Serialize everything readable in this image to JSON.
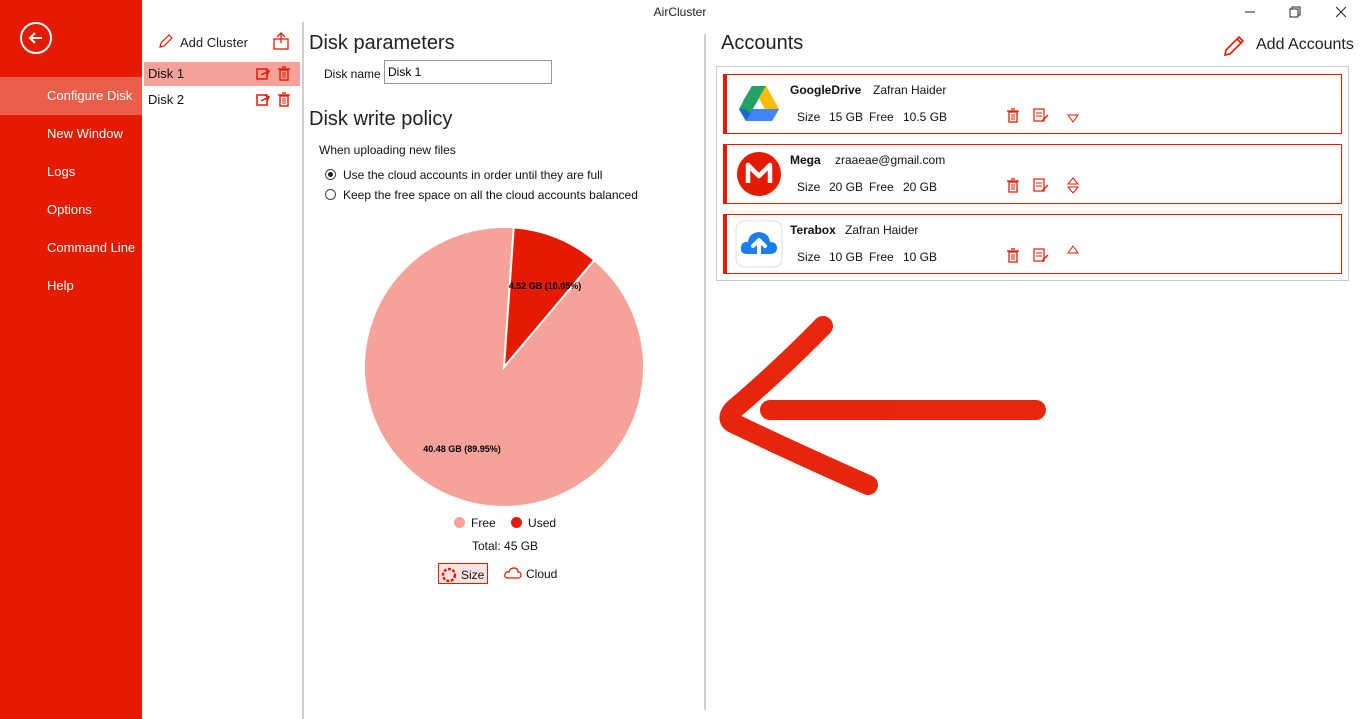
{
  "window": {
    "title": "AirCluster"
  },
  "sidebar": {
    "items": [
      {
        "label": "Configure Disk",
        "active": true
      },
      {
        "label": "New Window"
      },
      {
        "label": "Logs"
      },
      {
        "label": "Options"
      },
      {
        "label": "Command Line"
      },
      {
        "label": "Help"
      }
    ]
  },
  "clusters": {
    "add_label": "Add Cluster",
    "disks": [
      {
        "name": "Disk 1",
        "selected": true
      },
      {
        "name": "Disk 2"
      }
    ]
  },
  "disk_parameters": {
    "title": "Disk parameters",
    "name_label": "Disk name",
    "name_value": "Disk 1"
  },
  "write_policy": {
    "title": "Disk write policy",
    "caption": "When uploading new files",
    "options": [
      {
        "label": "Use the cloud accounts in order until they are full",
        "checked": true
      },
      {
        "label": "Keep the free space on all the cloud accounts balanced",
        "checked": false
      }
    ]
  },
  "chart_data": {
    "type": "pie",
    "slices": [
      {
        "label": "Free",
        "value": 40.48,
        "display": "40.48 GB (89.95%)",
        "color": "#f4a29a"
      },
      {
        "label": "Used",
        "value": 4.52,
        "display": "4.52 GB (10.05%)",
        "color": "#e51b00"
      }
    ],
    "legend": [
      "Free",
      "Used"
    ],
    "total_label": "Total: 45 GB"
  },
  "view_toggle": {
    "size_label": "Size",
    "cloud_label": "Cloud",
    "selected": "Size"
  },
  "accounts": {
    "title": "Accounts",
    "add_label": "Add Accounts",
    "size_label": "Size",
    "free_label": "Free",
    "items": [
      {
        "provider": "GoogleDrive",
        "user": "Zafran Haider",
        "size": "15 GB",
        "free": "10.5 GB",
        "order_icon": "move-down-icon"
      },
      {
        "provider": "Mega",
        "user": "zraaeae@gmail.com",
        "size": "20 GB",
        "free": "20 GB",
        "order_icon": "move-up-down-icon"
      },
      {
        "provider": "Terabox",
        "user": "Zafran Haider",
        "size": "10 GB",
        "free": "10 GB",
        "order_icon": "move-up-icon"
      }
    ]
  },
  "colors": {
    "accent": "#e51b00",
    "accent_light": "#f4a29a",
    "sidebar_active": "#ea5f4c"
  }
}
